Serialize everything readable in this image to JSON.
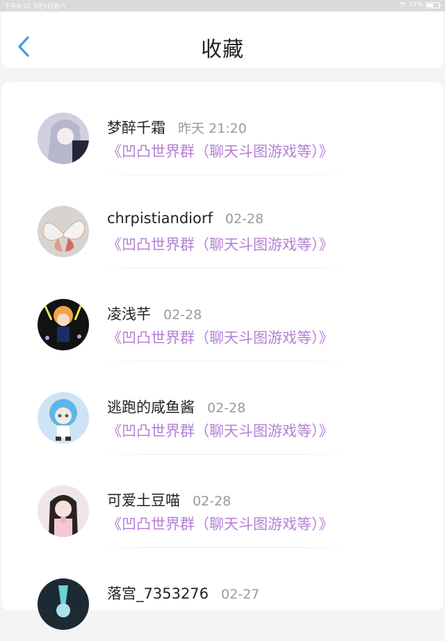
{
  "status_bar": {
    "time_date": "下午8:32  3月5日周六",
    "battery": "52%"
  },
  "header": {
    "title": "收藏",
    "back_icon": "chevron-left-icon"
  },
  "favorites": [
    {
      "name": "梦醉千霜",
      "time": "昨天 21:20",
      "group": "《凹凸世界群（聊天斗图游戏等）》"
    },
    {
      "name": "chrpistiandiorf",
      "time": "02-28",
      "group": "《凹凸世界群（聊天斗图游戏等）》"
    },
    {
      "name": "凌浅芊",
      "time": "02-28",
      "group": "《凹凸世界群（聊天斗图游戏等）》"
    },
    {
      "name": "逃跑的咸鱼酱",
      "time": "02-28",
      "group": "《凹凸世界群（聊天斗图游戏等）》"
    },
    {
      "name": "可爱土豆喵",
      "time": "02-28",
      "group": "《凹凸世界群（聊天斗图游戏等）》"
    },
    {
      "name": "落宫_7353276",
      "time": "02-27",
      "group": ""
    }
  ],
  "colors": {
    "accent": "#3c9ce6",
    "link": "#b57fd6"
  }
}
